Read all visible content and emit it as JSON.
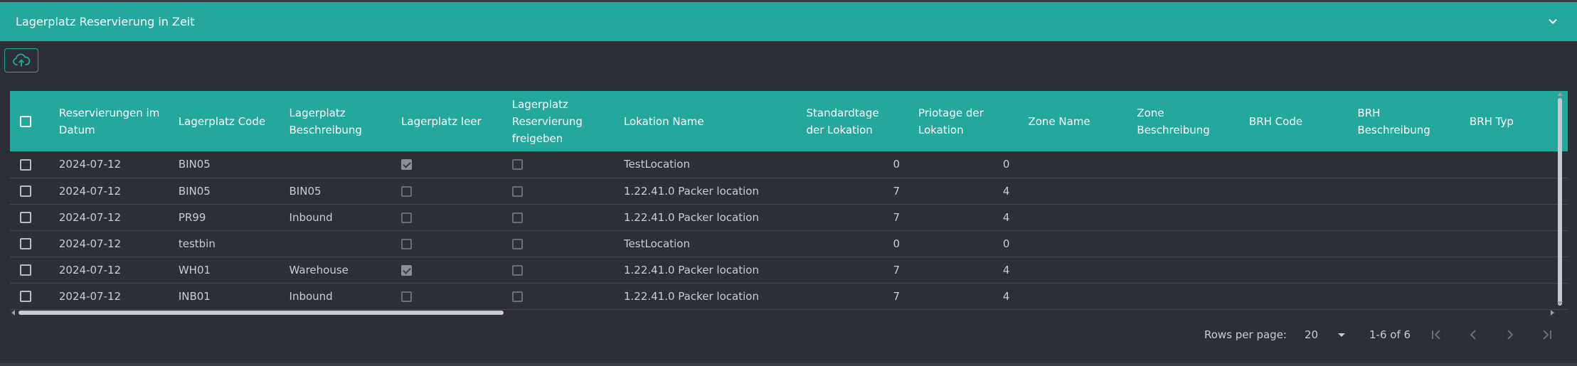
{
  "panel": {
    "title": "Lagerplatz Reservierung in Zeit"
  },
  "toolbar": {
    "upload_icon": "cloud-upload-icon"
  },
  "table": {
    "columns": [
      "Reservierungen im Datum",
      "Lagerplatz Code",
      "Lagerplatz Beschreibung",
      "Lagerplatz leer",
      "Lagerplatz Reservierung freigeben",
      "Lokation Name",
      "Standardtage der Lokation",
      "Priotage der Lokation",
      "Zone Name",
      "Zone Beschreibung",
      "BRH Code",
      "BRH Beschreibung",
      "BRH Typ"
    ],
    "rows": [
      {
        "date": "2024-07-12",
        "code": "BIN05",
        "desc": "",
        "empty": true,
        "release": false,
        "location": "TestLocation",
        "std_days": "0",
        "prio_days": "0"
      },
      {
        "date": "2024-07-12",
        "code": "BIN05",
        "desc": "BIN05",
        "empty": false,
        "release": false,
        "location": "1.22.41.0 Packer location",
        "std_days": "7",
        "prio_days": "4"
      },
      {
        "date": "2024-07-12",
        "code": "PR99",
        "desc": "Inbound",
        "empty": false,
        "release": false,
        "location": "1.22.41.0 Packer location",
        "std_days": "7",
        "prio_days": "4"
      },
      {
        "date": "2024-07-12",
        "code": "testbin",
        "desc": "",
        "empty": false,
        "release": false,
        "location": "TestLocation",
        "std_days": "0",
        "prio_days": "0"
      },
      {
        "date": "2024-07-12",
        "code": "WH01",
        "desc": "Warehouse",
        "empty": true,
        "release": false,
        "location": "1.22.41.0 Packer location",
        "std_days": "7",
        "prio_days": "4"
      },
      {
        "date": "2024-07-12",
        "code": "INB01",
        "desc": "Inbound",
        "empty": false,
        "release": false,
        "location": "1.22.41.0 Packer location",
        "std_days": "7",
        "prio_days": "4"
      }
    ]
  },
  "pagination": {
    "rows_per_page_label": "Rows per page:",
    "rows_per_page": "20",
    "range": "1-6 of 6"
  },
  "colors": {
    "accent": "#24a89d",
    "background": "#2e2f36"
  }
}
